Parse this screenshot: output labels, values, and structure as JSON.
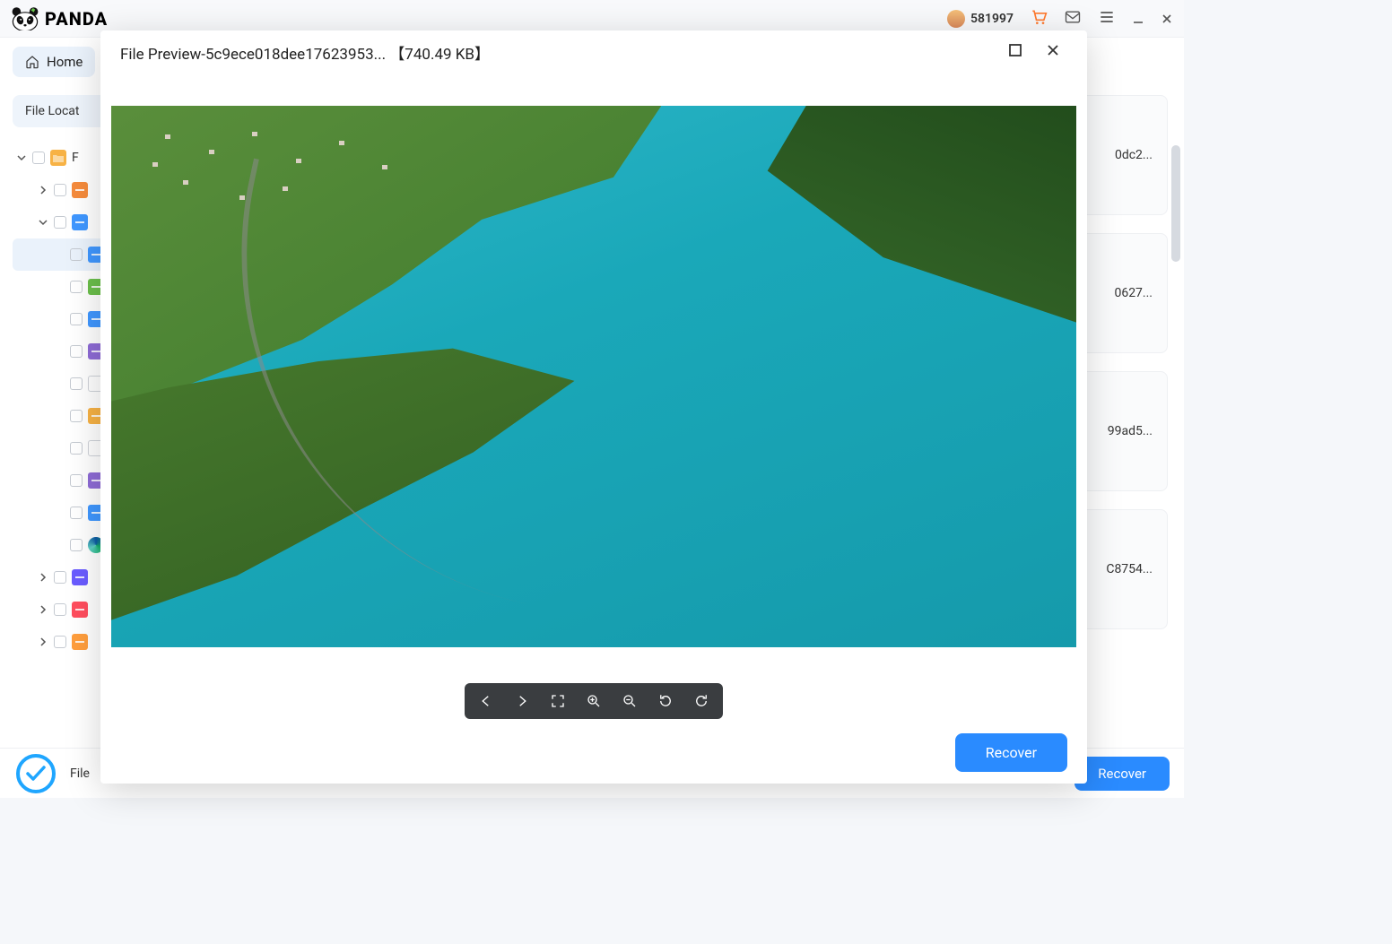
{
  "app": {
    "brand": "PANDA",
    "user_id": "581997"
  },
  "nav": {
    "home_label": "Home"
  },
  "sidebar": {
    "tab_label": "File Locat",
    "tree": [
      {
        "depth": 0,
        "caret": "down",
        "icon": "folder",
        "color": "#f7b245",
        "label": "F"
      },
      {
        "depth": 1,
        "caret": "right",
        "icon": "doc",
        "color": "#f58b3c",
        "label": ""
      },
      {
        "depth": 1,
        "caret": "down",
        "icon": "image",
        "color": "#3f97ff",
        "label": "",
        "active_parent": true
      },
      {
        "depth": 2,
        "caret": "",
        "icon": "doc",
        "color": "#3f97ff",
        "label": "",
        "selected": true
      },
      {
        "depth": 2,
        "caret": "",
        "icon": "doc",
        "color": "#6bbf4b",
        "label": ""
      },
      {
        "depth": 2,
        "caret": "",
        "icon": "doc",
        "color": "#3f97ff",
        "label": ""
      },
      {
        "depth": 2,
        "caret": "",
        "icon": "doc",
        "color": "#8e6bd6",
        "label": ""
      },
      {
        "depth": 2,
        "caret": "",
        "icon": "file",
        "color": "#cfd3d9",
        "label": ""
      },
      {
        "depth": 2,
        "caret": "",
        "icon": "doc",
        "color": "#f7b245",
        "label": ""
      },
      {
        "depth": 2,
        "caret": "",
        "icon": "file",
        "color": "#cfd3d9",
        "label": ""
      },
      {
        "depth": 2,
        "caret": "",
        "icon": "doc",
        "color": "#8e6bd6",
        "label": ""
      },
      {
        "depth": 2,
        "caret": "",
        "icon": "image",
        "color": "#3f97ff",
        "label": ""
      },
      {
        "depth": 2,
        "caret": "",
        "icon": "edge",
        "color": "#17b169",
        "label": ""
      },
      {
        "depth": 1,
        "caret": "right",
        "icon": "video",
        "color": "#6a5cff",
        "label": ""
      },
      {
        "depth": 1,
        "caret": "right",
        "icon": "audio",
        "color": "#ff4d5e",
        "label": ""
      },
      {
        "depth": 1,
        "caret": "right",
        "icon": "other",
        "color": "#ff9e3d",
        "label": ""
      }
    ]
  },
  "cards": [
    {
      "name": "0dc2..."
    },
    {
      "name": "0627..."
    },
    {
      "name": "99ad5..."
    },
    {
      "name": "C8754..."
    }
  ],
  "bottom": {
    "status_prefix": "File",
    "recover_label": "Recover"
  },
  "preview": {
    "title": "File Preview-5c9ece018dee17623953...  【740.49 KB】",
    "recover_label": "Recover",
    "tools": [
      "prev",
      "next",
      "fullscreen",
      "zoom-in",
      "zoom-out",
      "rotate-left",
      "rotate-right"
    ]
  }
}
